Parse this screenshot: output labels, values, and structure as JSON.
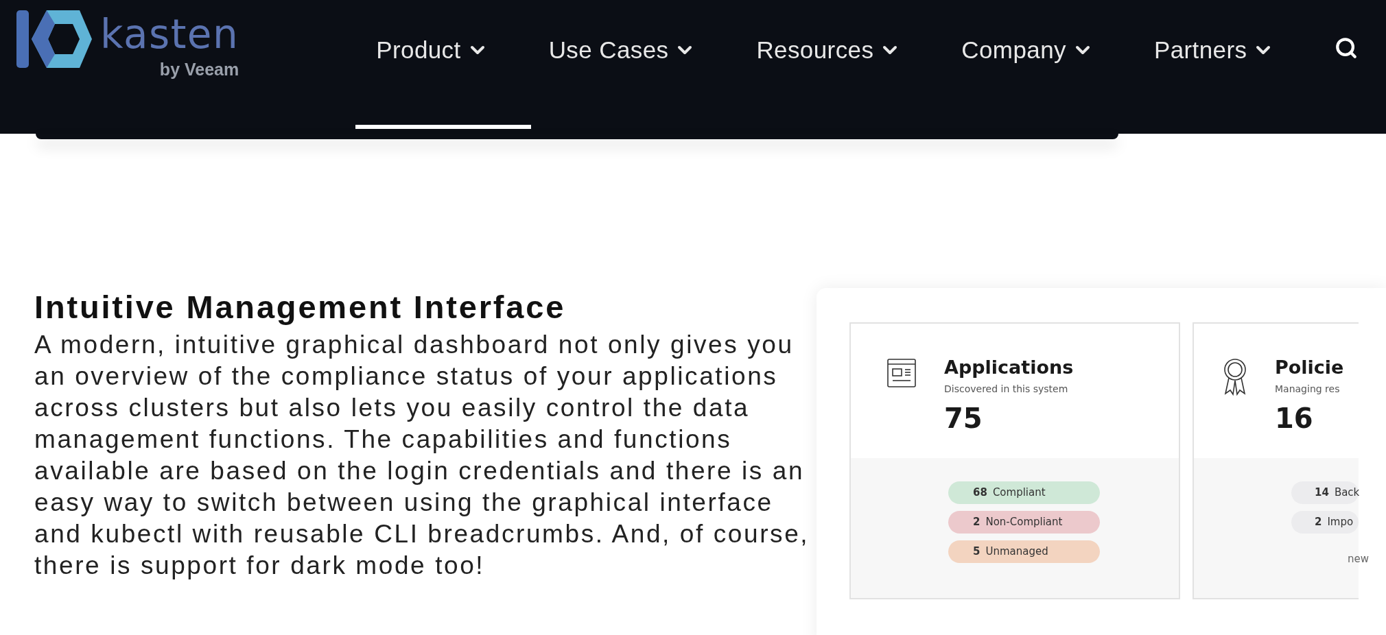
{
  "header": {
    "logo": {
      "name": "kasten",
      "tagline": "by Veeam"
    },
    "nav": [
      {
        "label": "Product",
        "selected": true
      },
      {
        "label": "Use Cases",
        "selected": false
      },
      {
        "label": "Resources",
        "selected": false
      },
      {
        "label": "Company",
        "selected": false
      },
      {
        "label": "Partners",
        "selected": false
      }
    ]
  },
  "section": {
    "title": "Intuitive Management Interface",
    "body": "A modern, intuitive graphical dashboard not only gives you an overview of the compliance status of your applications across clusters but also lets you easily control the data management functions. The capabilities and functions available are based on the login credentials and there is an easy way to switch between using the graphical interface and kubectl with reusable CLI breadcrumbs. And, of course, there is support for dark mode too!"
  },
  "dashboard": {
    "cards": [
      {
        "kind": "applications",
        "title": "Applications",
        "subtitle": "Discovered in this system",
        "count": "75",
        "pills": [
          {
            "count": "68",
            "label": "Compliant",
            "color": "#cfe8d7"
          },
          {
            "count": "2",
            "label": "Non-Compliant",
            "color": "#ecc9cc"
          },
          {
            "count": "5",
            "label": "Unmanaged",
            "color": "#f3d4c0"
          }
        ]
      },
      {
        "kind": "policies",
        "title": "Policie",
        "subtitle": "Managing res",
        "count": "16",
        "pills": [
          {
            "count": "14",
            "label": "Back",
            "color": "#ececee"
          },
          {
            "count": "2",
            "label": "Impo",
            "color": "#ececee"
          }
        ],
        "action": "new"
      }
    ]
  }
}
